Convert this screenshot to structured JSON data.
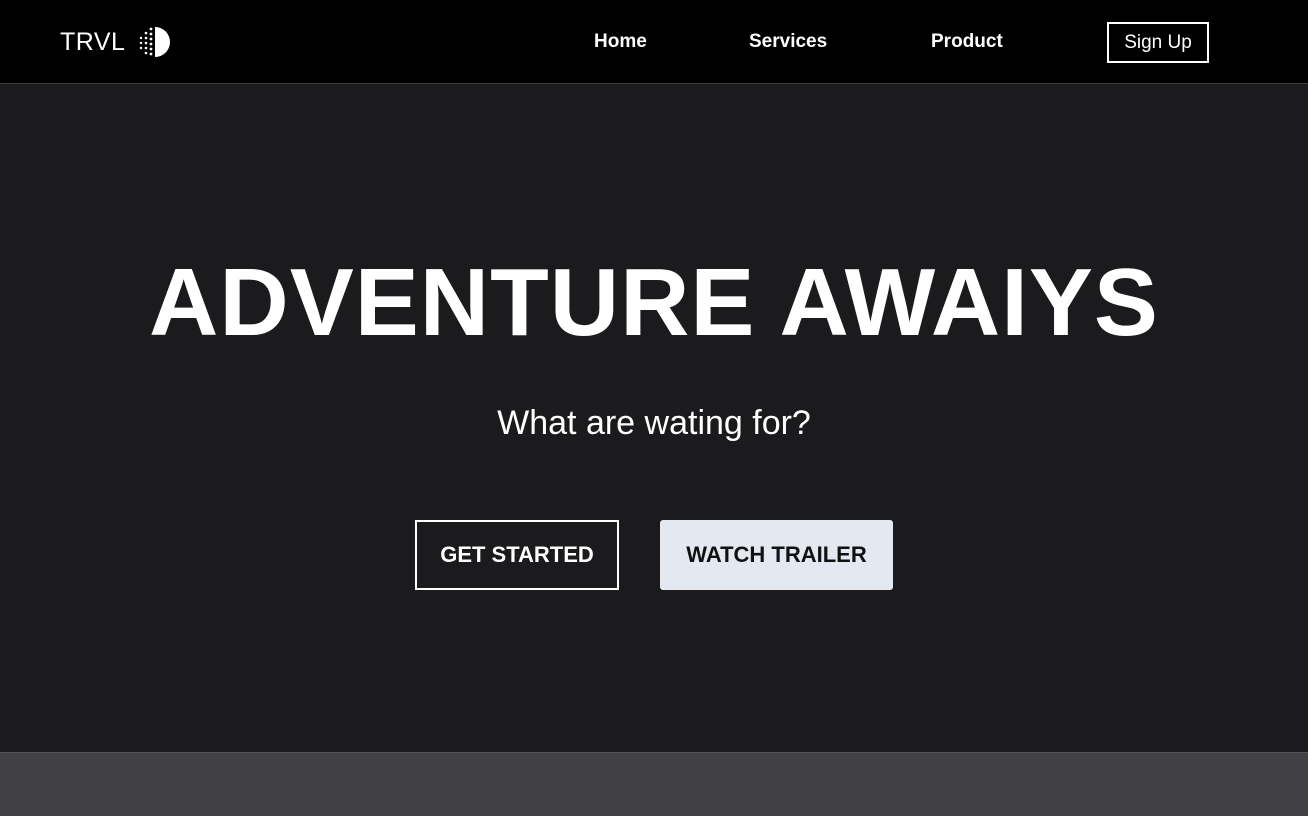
{
  "navbar": {
    "brand": {
      "text": "TRVL",
      "icon": "dotted-half-circle-logo-icon"
    },
    "links": {
      "home": "Home",
      "services": "Services",
      "product": "Product"
    },
    "signup_label": "Sign Up"
  },
  "hero": {
    "title": "ADVENTURE AWAIYS",
    "subtitle": "What are wating for?",
    "get_started_label": "GET STARTED",
    "watch_trailer_label": "WATCH TRAILER"
  },
  "colors": {
    "navbar_background": "#000000",
    "hero_background": "#1b1a1c",
    "footer_background": "#414044",
    "secondary_button_background": "#e4e9f1",
    "text": "#ffffff"
  }
}
